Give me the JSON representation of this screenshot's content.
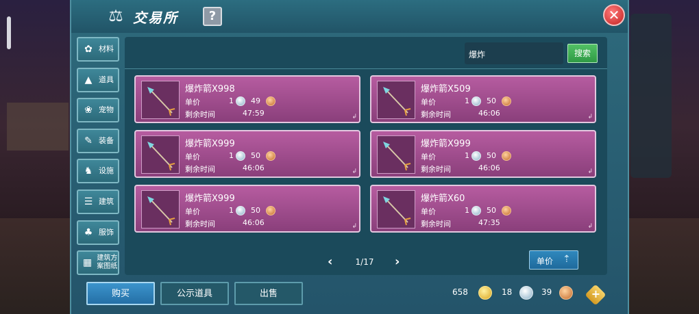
{
  "title": "交易所",
  "help_label": "?",
  "close_label": "✕",
  "categories": [
    {
      "label": "材料",
      "icon": "materials-icon"
    },
    {
      "label": "道具",
      "icon": "potion-icon"
    },
    {
      "label": "宠物",
      "icon": "paw-icon"
    },
    {
      "label": "装备",
      "icon": "equipment-icon"
    },
    {
      "label": "设施",
      "icon": "facility-icon"
    },
    {
      "label": "建筑",
      "icon": "building-icon"
    },
    {
      "label": "服饰",
      "icon": "clothing-icon"
    },
    {
      "label": "建筑方案图纸",
      "icon": "blueprint-icon"
    }
  ],
  "search": {
    "value": "爆炸",
    "button": "搜索"
  },
  "listing_labels": {
    "unit_price": "单价",
    "time_left": "剩余时间"
  },
  "listings": [
    {
      "name": "爆炸箭X998",
      "silver": "1",
      "copper": "49",
      "time": "47:59"
    },
    {
      "name": "爆炸箭X509",
      "silver": "1",
      "copper": "50",
      "time": "46:06"
    },
    {
      "name": "爆炸箭X999",
      "silver": "1",
      "copper": "50",
      "time": "46:06"
    },
    {
      "name": "爆炸箭X999",
      "silver": "1",
      "copper": "50",
      "time": "46:06"
    },
    {
      "name": "爆炸箭X999",
      "silver": "1",
      "copper": "50",
      "time": "46:06"
    },
    {
      "name": "爆炸箭X60",
      "silver": "1",
      "copper": "50",
      "time": "47:35"
    }
  ],
  "pager": {
    "text": "1/17",
    "prev": "‹",
    "next": "›"
  },
  "sort_button": "单价",
  "actions": {
    "buy": "购买",
    "showcase": "公示道具",
    "sell": "出售"
  },
  "wallet": {
    "gold": "658",
    "silver": "18",
    "copper": "39"
  },
  "colors": {
    "item_bg": "#b65ca0",
    "accent_green": "#3faa52",
    "panel": "#1b4a5b"
  }
}
